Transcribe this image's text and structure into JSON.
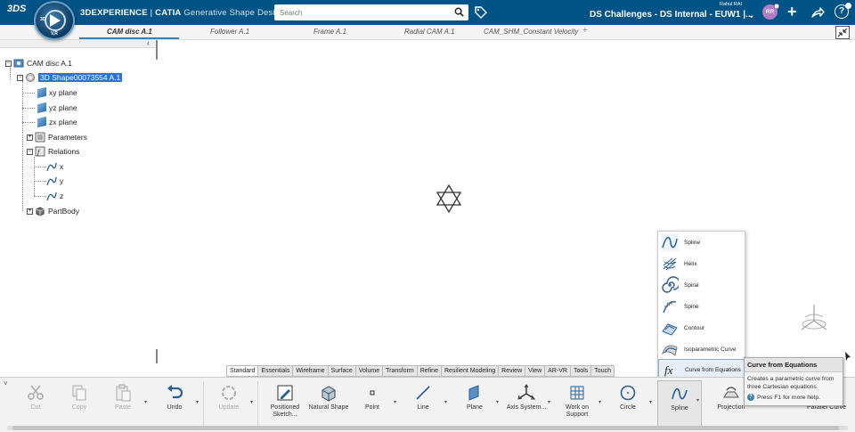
{
  "topbar": {
    "ds_logo": "3DS",
    "compass": {
      "top_label": "3D",
      "bottom_label": "V,R"
    },
    "brand": "3DEXPERIENCE",
    "separator": " | ",
    "product": "CATIA",
    "app": " Generative Shape Design",
    "search": {
      "placeholder": "Search",
      "value": ""
    },
    "collab_space": "DS Challenges - DS Internal - EUW1 |...",
    "user_name": "Rahul RAI",
    "avatar_initials": "RR",
    "colors": {
      "bar": "#005386",
      "accent": "#3d7fb0",
      "avatar": "#b17dc8"
    }
  },
  "tabs": [
    {
      "label": "CAM disc A.1",
      "active": true
    },
    {
      "label": "Follower A.1",
      "active": false
    },
    {
      "label": "Frame A.1",
      "active": false
    },
    {
      "label": "Radial CAM A.1",
      "active": false
    },
    {
      "label": "CAM_SHM_Constant Velocity",
      "active": false
    }
  ],
  "tab_add": "+",
  "tree": {
    "collapse_symbol": "‹",
    "root": "CAM disc A.1",
    "shape": "3D Shape00073554 A.1",
    "planes": [
      "xy plane",
      "yz plane",
      "zx plane"
    ],
    "parameters": "Parameters",
    "relations": "Relations",
    "relation_items": [
      "x",
      "y",
      "z"
    ],
    "partbody": "PartBody"
  },
  "dropdown": {
    "items": [
      {
        "label": "Spline",
        "icon": "spline-icon"
      },
      {
        "label": "Helix",
        "icon": "helix-icon"
      },
      {
        "label": "Spiral",
        "icon": "spiral-icon"
      },
      {
        "label": "Spine",
        "icon": "spine-icon"
      },
      {
        "label": "Contour",
        "icon": "contour-icon"
      },
      {
        "label": "Isoparametric Curve",
        "icon": "isoparametric-curve-icon"
      },
      {
        "label": "Curve from Equations",
        "icon": "curve-from-equations-icon",
        "active": true
      }
    ]
  },
  "tooltip": {
    "title": "Curve from Equations",
    "description": "Creates a parametric curve from three Cartesian equations.",
    "help": "Press F1 for more help."
  },
  "section_tabs": [
    "Standard",
    "Essentials",
    "Wireframe",
    "Surface",
    "Volume",
    "Transform",
    "Refine",
    "Resilient Modeling",
    "Review",
    "View",
    "AR-VR",
    "Tools",
    "Touch"
  ],
  "active_section": "Standard",
  "action_bar": {
    "collapse_symbol": "˅",
    "tools": [
      {
        "label": "Cut",
        "disabled": true
      },
      {
        "label": "Copy",
        "disabled": true
      },
      {
        "label": "Paste",
        "disabled": true
      },
      {
        "label": "Undo",
        "disabled": false
      },
      {
        "label": "Update",
        "disabled": true
      },
      {
        "label": "Positioned Sketch...",
        "disabled": false
      },
      {
        "label": "Natural Shape",
        "disabled": false
      },
      {
        "label": "Point",
        "disabled": false
      },
      {
        "label": "Line",
        "disabled": false
      },
      {
        "label": "Plane",
        "disabled": false
      },
      {
        "label": "Axis System...",
        "disabled": false
      },
      {
        "label": "Work on Support",
        "disabled": false
      },
      {
        "label": "Circle",
        "disabled": false
      },
      {
        "label": "Spline",
        "disabled": false
      },
      {
        "label": "Projection",
        "disabled": false
      },
      {
        "label": "Parallel Curve",
        "disabled": false
      }
    ]
  }
}
